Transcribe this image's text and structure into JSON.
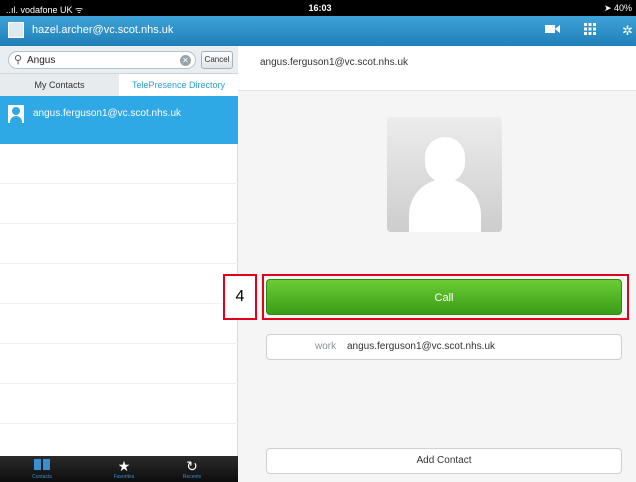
{
  "status_bar": {
    "carrier": "..ıl. vodafone UK ᯤ",
    "time": "16:03",
    "battery": "➤ 40%"
  },
  "header": {
    "user": "hazel.archer@vc.scot.nhs.uk",
    "icons": [
      "video-camera-icon",
      "keypad-grid-icon",
      "settings-gear-icon"
    ]
  },
  "search": {
    "value": "Angus",
    "cancel_label": "Cancel"
  },
  "tabs": {
    "my_contacts": "My Contacts",
    "directory": "TelePresence Directory",
    "active": "directory"
  },
  "results": [
    {
      "name": "angus.ferguson1@vc.scot.nhs.uk",
      "selected": true
    }
  ],
  "bottom_tabs": [
    {
      "icon": "contacts-book-icon",
      "label": "Contacts"
    },
    {
      "icon": "favorites-star-icon",
      "label": "Favorites"
    },
    {
      "icon": "recents-clock-icon",
      "label": "Recents"
    }
  ],
  "detail": {
    "title": "angus.ferguson1@vc.scot.nhs.uk",
    "call_label": "Call",
    "work_label": "work",
    "work_value": "angus.ferguson1@vc.scot.nhs.uk",
    "add_contact_label": "Add Contact"
  },
  "annotation": {
    "step_number": "4",
    "color": "#e2001a"
  },
  "colors": {
    "header_blue": "#2a8cc7",
    "selection_blue": "#2fa8e6",
    "call_green": "#4cb323"
  }
}
